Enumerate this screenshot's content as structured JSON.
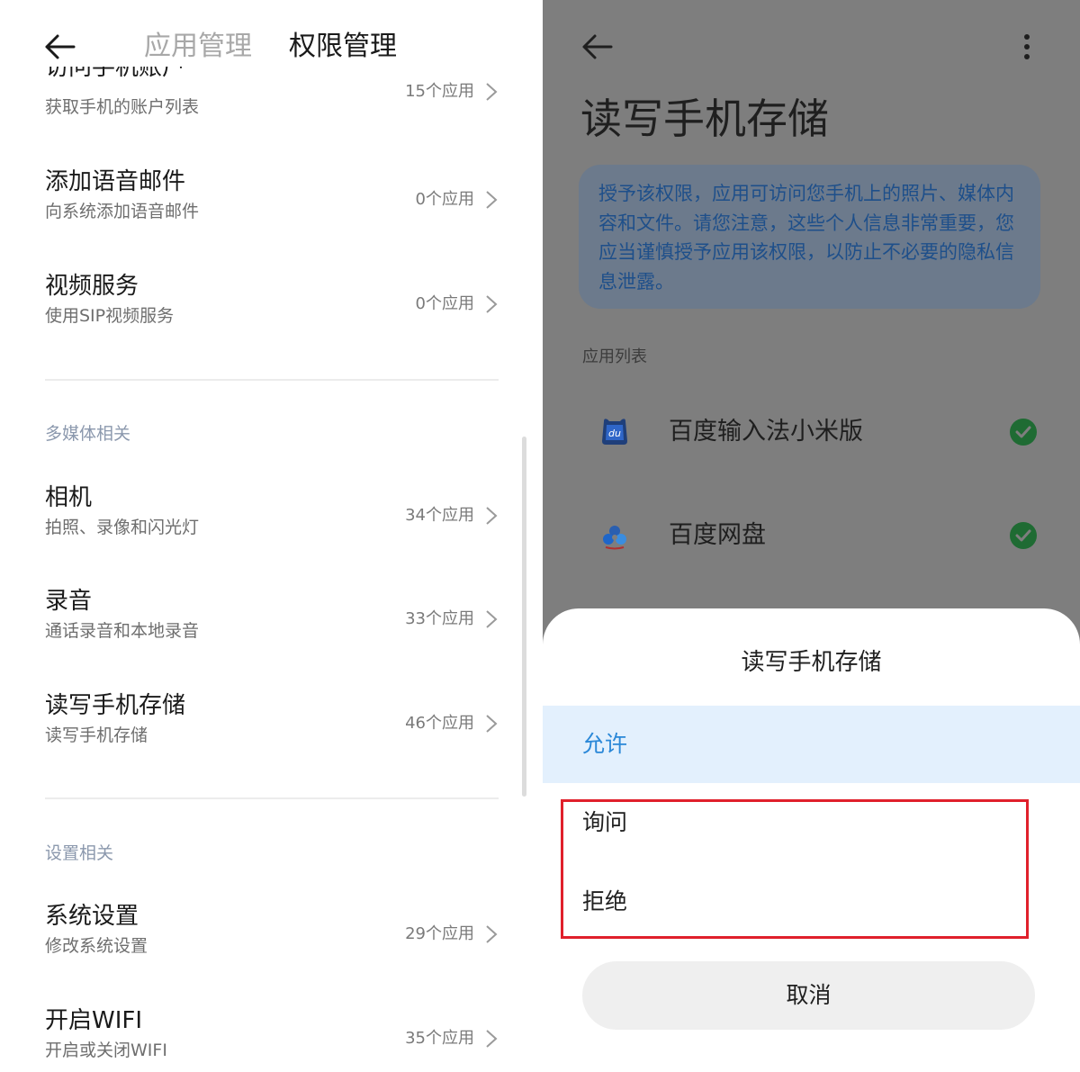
{
  "left": {
    "header": {
      "tab_app_manage": "应用管理",
      "tab_perm_manage": "权限管理"
    },
    "cutoff_item": {
      "title": "访问手机账户",
      "subtitle": "获取手机的账户列表",
      "count": "15个应用"
    },
    "items_top": [
      {
        "title": "添加语音邮件",
        "subtitle": "向系统添加语音邮件",
        "count": "0个应用"
      },
      {
        "title": "视频服务",
        "subtitle": "使用SIP视频服务",
        "count": "0个应用"
      }
    ],
    "section_media": {
      "label": "多媒体相关",
      "items": [
        {
          "title": "相机",
          "subtitle": "拍照、录像和闪光灯",
          "count": "34个应用"
        },
        {
          "title": "录音",
          "subtitle": "通话录音和本地录音",
          "count": "33个应用"
        },
        {
          "title": "读写手机存储",
          "subtitle": "读写手机存储",
          "count": "46个应用"
        }
      ]
    },
    "section_settings": {
      "label": "设置相关",
      "items": [
        {
          "title": "系统设置",
          "subtitle": "修改系统设置",
          "count": "29个应用"
        },
        {
          "title": "开启WIFI",
          "subtitle": "开启或关闭WIFI",
          "count": "35个应用"
        }
      ]
    }
  },
  "right": {
    "page_title": "读写手机存储",
    "notice": "授予该权限，应用可访问您手机上的照片、媒体内容和文件。请您注意，这些个人信息非常重要，您应当谨慎授予应用该权限，以防止不必要的隐私信息泄露。",
    "list_label": "应用列表",
    "apps": [
      {
        "name": "百度输入法小米版",
        "icon": "baidu-input-icon",
        "granted": true
      },
      {
        "name": "百度网盘",
        "icon": "baidu-netdisk-icon",
        "granted": true
      }
    ],
    "sheet": {
      "title": "读写手机存储",
      "options": {
        "allow": "允许",
        "ask": "询问",
        "deny": "拒绝"
      },
      "cancel": "取消"
    }
  },
  "colors": {
    "accent_blue": "#2b88d8",
    "allow_bg": "#e3f0fd",
    "check_green": "#1f6b33",
    "highlight_red": "#e0202b"
  }
}
